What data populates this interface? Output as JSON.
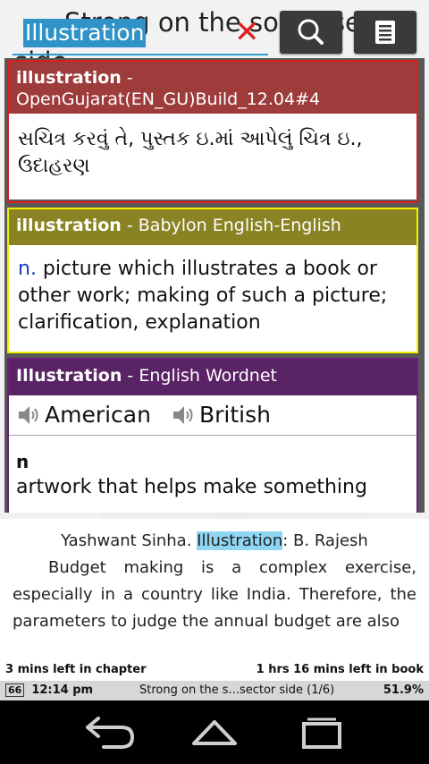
{
  "background": {
    "title_line1": "Strong on the social sector",
    "title_line2": "side"
  },
  "search": {
    "query": "Illustration"
  },
  "icons": {
    "clear": "close-x-icon",
    "search": "magnifier-icon",
    "menu": "list-menu-icon",
    "speaker": "speaker-icon",
    "back": "back-arrow-icon",
    "home": "home-icon",
    "recents": "recent-apps-icon"
  },
  "cards": {
    "card1": {
      "word": "illustration",
      "source": " - OpenGujarat(EN_GU)Build_12.04#4",
      "definition": "સચિત્ર કરવું તે, પુસ્તક ઇ.માં આપેલું ચિત્ર ઇ., ઉદાહરણ",
      "border_color": "#e01b1b"
    },
    "card2": {
      "word": "illustration",
      "source": " - Babylon English-English",
      "pos": "n.",
      "definition": " picture which illustrates a book or other work; making of such a picture; clarification, explanation",
      "border_color": "#f0f000"
    },
    "card3": {
      "word": "Illustration",
      "source": " - English Wordnet",
      "audio_american": "American",
      "audio_british": "British",
      "pos": "n",
      "definition": "artwork that helps make something"
    }
  },
  "book": {
    "caption_prefix": "Yashwant Sinha. ",
    "caption_highlight": "Illustration",
    "caption_suffix": ": B. Rajesh",
    "paragraph": "Budget making is a complex exercise, especially in a country like India. Therefore, the parameters to judge the annual budget are also"
  },
  "status": {
    "chapter_left": "3 mins left in chapter",
    "book_left": "1 hrs 16 mins left in book",
    "battery": "66",
    "time": "12:14 pm",
    "chapter_title": "Strong on the s...sector side (1/6)",
    "progress": "51.9%"
  }
}
